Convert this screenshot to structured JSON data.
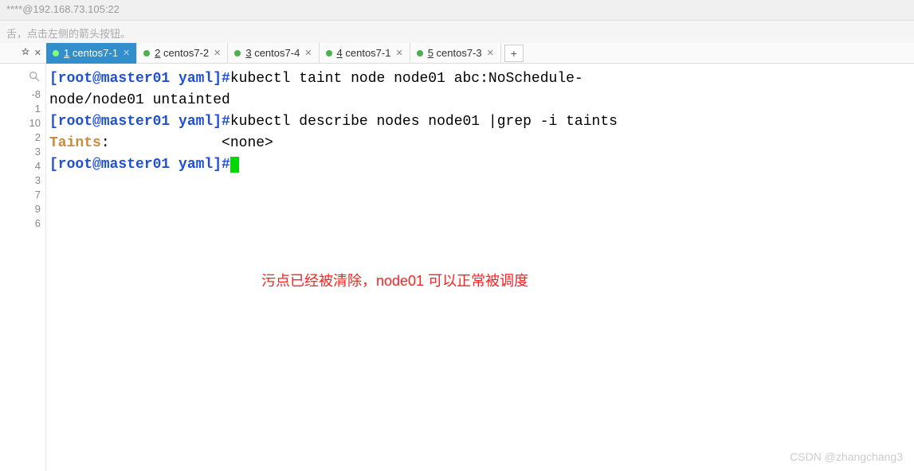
{
  "titlebar": {
    "text": "****@192.168.73.105:22"
  },
  "hintbar": {
    "text": "舌，点击左侧的箭头按钮。"
  },
  "toolbar": {
    "pin": "📌",
    "close": "✕",
    "add": "+"
  },
  "tabs": [
    {
      "num": "1",
      "label": "centos7-1",
      "active": true
    },
    {
      "num": "2",
      "label": "centos7-2",
      "active": false
    },
    {
      "num": "3",
      "label": "centos7-4",
      "active": false
    },
    {
      "num": "4",
      "label": "centos7-1",
      "active": false
    },
    {
      "num": "5",
      "label": "centos7-3",
      "active": false
    }
  ],
  "sidebar": {
    "nums": [
      "-8",
      "1",
      "10",
      "2",
      "3",
      "4",
      "3",
      "7",
      "9",
      "6"
    ]
  },
  "terminal": {
    "prompt_open": "[root@master01 ",
    "prompt_path": "yaml",
    "prompt_close": "]#",
    "cmd1": "kubectl taint node node01 abc:NoSchedule-",
    "out1": "node/node01 untainted",
    "cmd2": "kubectl describe nodes node01 |grep -i taints",
    "taints_label": "Taints",
    "taints_value": ":             <none>",
    "annotation": "污点已经被清除，node01 可以正常被调度"
  },
  "watermark": "CSDN @zhangchang3"
}
